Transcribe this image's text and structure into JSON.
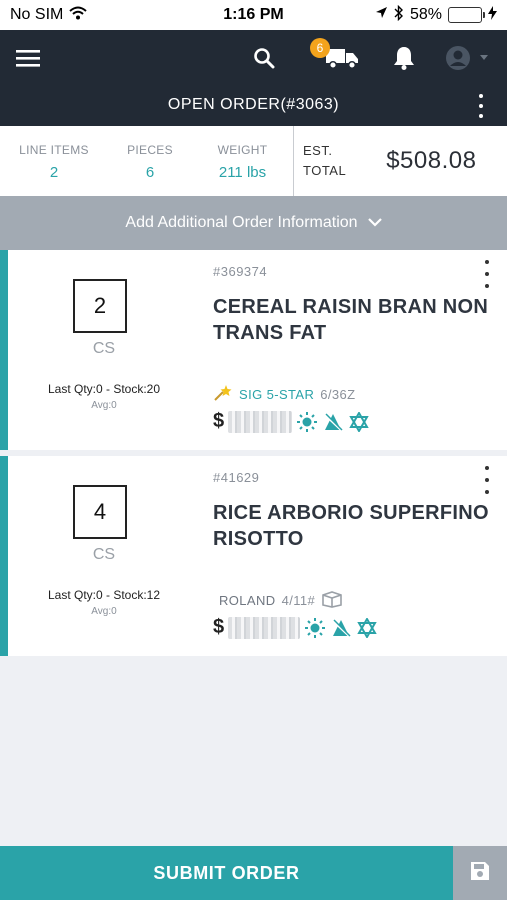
{
  "status_bar": {
    "carrier": "No SIM",
    "time": "1:16 PM",
    "battery": "58%",
    "battery_level": 0.58
  },
  "nav": {
    "cart_count": "6",
    "title": "OPEN ORDER(#3063)"
  },
  "summary": {
    "line_items_label": "LINE ITEMS",
    "line_items": "2",
    "pieces_label": "PIECES",
    "pieces": "6",
    "weight_label": "WEIGHT",
    "weight": "211 lbs",
    "total_label_1": "EST.",
    "total_label_2": "TOTAL",
    "total": "$508.08"
  },
  "add_info": {
    "label": "Add Additional Order Information"
  },
  "items": [
    {
      "qty": "2",
      "unit": "CS",
      "stock": "Last Qty:0 - Stock:20",
      "avg": "Avg:0",
      "sku": "#369374",
      "name": "CEREAL RAISIN BRAN NON TRANS FAT",
      "brand": "SIG 5-STAR",
      "pack": "6/36Z",
      "price_prefix": "$"
    },
    {
      "qty": "4",
      "unit": "CS",
      "stock": "Last Qty:0 - Stock:12",
      "avg": "Avg:0",
      "sku": "#41629",
      "name": "RICE ARBORIO SUPERFINO RISOTTO",
      "brand": "ROLAND",
      "pack": "4/11#",
      "price_prefix": "$"
    }
  ],
  "footer": {
    "submit_label": "SUBMIT ORDER"
  },
  "colors": {
    "teal": "#2aa3a8",
    "navbar": "#222a35",
    "badge": "#f3a31c",
    "gray_bar": "#a2aab3"
  }
}
